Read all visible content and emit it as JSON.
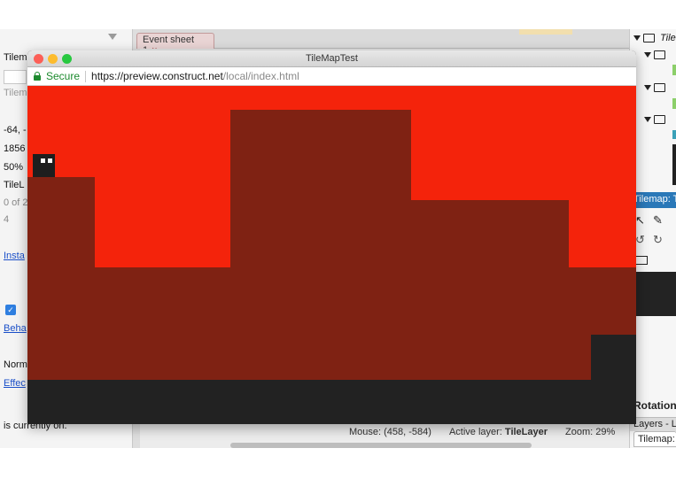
{
  "ide": {
    "tab_event": "Event sheet 1",
    "tab_close": "×",
    "left_panel": {
      "rows": [
        "Tilem",
        "Tilem",
        "-64, -",
        "1856",
        "50%",
        "TileL",
        "0 of 2",
        "4"
      ],
      "link_instance": "Insta",
      "link_behaviors": "Beha",
      "row_normal": "Norm",
      "link_effects": "Effec",
      "status_text": "is currently on."
    },
    "right_panel": {
      "top_label": "Tile",
      "tilemap_header": "Tilemap: T",
      "rotation_label": "Rotation",
      "layers_label": "Layers - L",
      "tilemap_tab": "Tilemap: T"
    },
    "status": {
      "mouse": "Mouse: (458, -584)",
      "active_layer_label": "Active layer:",
      "active_layer_value": "TileLayer",
      "zoom": "Zoom: 29%"
    }
  },
  "browser": {
    "title": "TileMapTest",
    "secure_label": "Secure",
    "url_host": "https://preview.construct.net",
    "url_path": "/local/index.html",
    "traffic_lights": {
      "close": "#fc5f57",
      "minimize": "#fdbc2e",
      "zoom": "#28c840"
    }
  },
  "game": {
    "colors": {
      "sky": "#f4230b",
      "dirt": "#7f2213",
      "ground": "#222222",
      "player": "#1e1e1e",
      "eyes": "#ffffff"
    }
  }
}
